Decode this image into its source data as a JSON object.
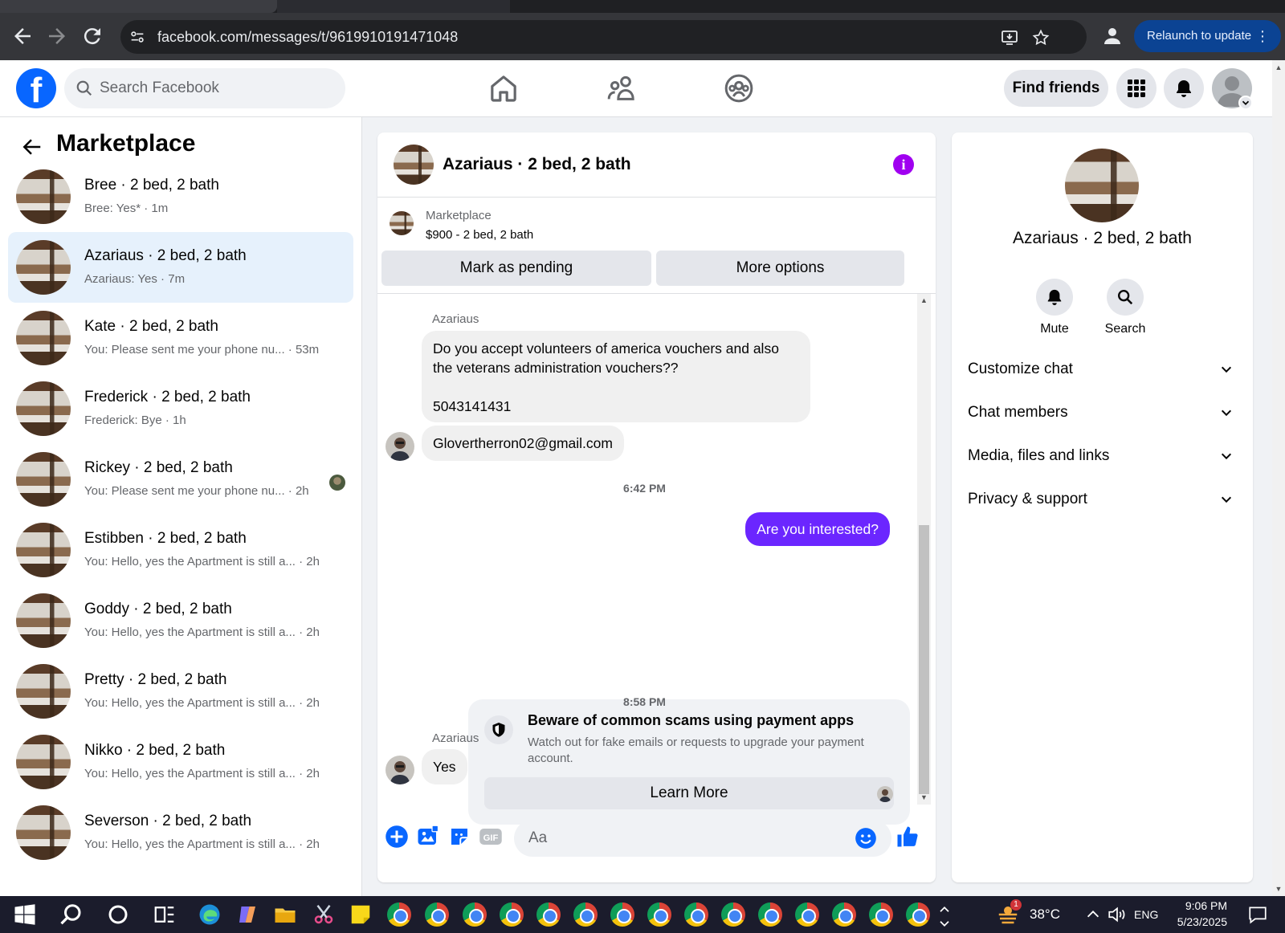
{
  "browser": {
    "url": "facebook.com/messages/t/9619910191471048",
    "relaunch_label": "Relaunch to update"
  },
  "fb_header": {
    "search_placeholder": "Search Facebook",
    "find_friends_label": "Find friends",
    "logo_letter": "f"
  },
  "left_panel": {
    "title": "Marketplace",
    "conversations": [
      {
        "name": "Bree · 2 bed, 2 bath",
        "preview": "Bree: Yes* · 1m",
        "active": false
      },
      {
        "name": "Azariaus · 2 bed, 2 bath",
        "preview": "Azariaus: Yes · 7m",
        "active": true
      },
      {
        "name": "Kate · 2 bed, 2 bath",
        "preview": "You: Please sent me your phone nu... · 53m",
        "active": false
      },
      {
        "name": "Frederick · 2 bed, 2 bath",
        "preview": "Frederick: Bye · 1h",
        "active": false
      },
      {
        "name": "Rickey · 2 bed, 2 bath",
        "preview": "You: Please sent me your phone nu... · 2h",
        "active": false
      },
      {
        "name": "Estibben · 2 bed, 2 bath",
        "preview": "You: Hello, yes the Apartment is still a... · 2h",
        "active": false
      },
      {
        "name": "Goddy · 2 bed, 2 bath",
        "preview": "You: Hello, yes the Apartment is still a... · 2h",
        "active": false
      },
      {
        "name": "Pretty · 2 bed, 2 bath",
        "preview": "You: Hello, yes the Apartment is still a... · 2h",
        "active": false
      },
      {
        "name": "Nikko · 2 bed, 2 bath",
        "preview": "You: Hello, yes the Apartment is still a... · 2h",
        "active": false
      },
      {
        "name": "Severson · 2 bed, 2 bath",
        "preview": "You: Hello, yes the Apartment is still a... · 2h",
        "active": false
      }
    ]
  },
  "chat": {
    "title": "Azariaus · 2 bed, 2 bath",
    "listing": {
      "source": "Marketplace",
      "price_line": "$900 - 2 bed, 2 bath",
      "mark_pending_label": "Mark as pending",
      "more_options_label": "More options"
    },
    "messages": {
      "sender1": "Azariaus",
      "msg1_line1": "Do you accept volunteers of america vouchers and also",
      "msg1_line2": "the veterans administration vouchers??",
      "msg1_line3": "5043141431",
      "msg2": "Glovertherron02@gmail.com",
      "time1": "6:42 PM",
      "msg3": "Are you interested?",
      "scam_title": "Beware of common scams using payment apps",
      "scam_body": "Watch out for fake emails or requests to upgrade your payment account.",
      "learn_more_label": "Learn More",
      "time2": "8:58 PM",
      "sender2": "Azariaus",
      "msg4": "Yes"
    },
    "composer_placeholder": "Aa"
  },
  "right_panel": {
    "name": "Azariaus · 2 bed, 2 bath",
    "mute_label": "Mute",
    "search_label": "Search",
    "rows": [
      "Customize chat",
      "Chat members",
      "Media, files and links",
      "Privacy & support"
    ]
  },
  "taskbar": {
    "temperature": "38°C",
    "language": "ENG",
    "time": "9:06 PM",
    "date": "5/23/2025",
    "weather_badge": "1"
  },
  "colors": {
    "fb_blue": "#0866ff",
    "outgoing_bubble": "#6b26ff",
    "info_icon": "#a000f0",
    "active_conv": "#e6f1fc"
  }
}
